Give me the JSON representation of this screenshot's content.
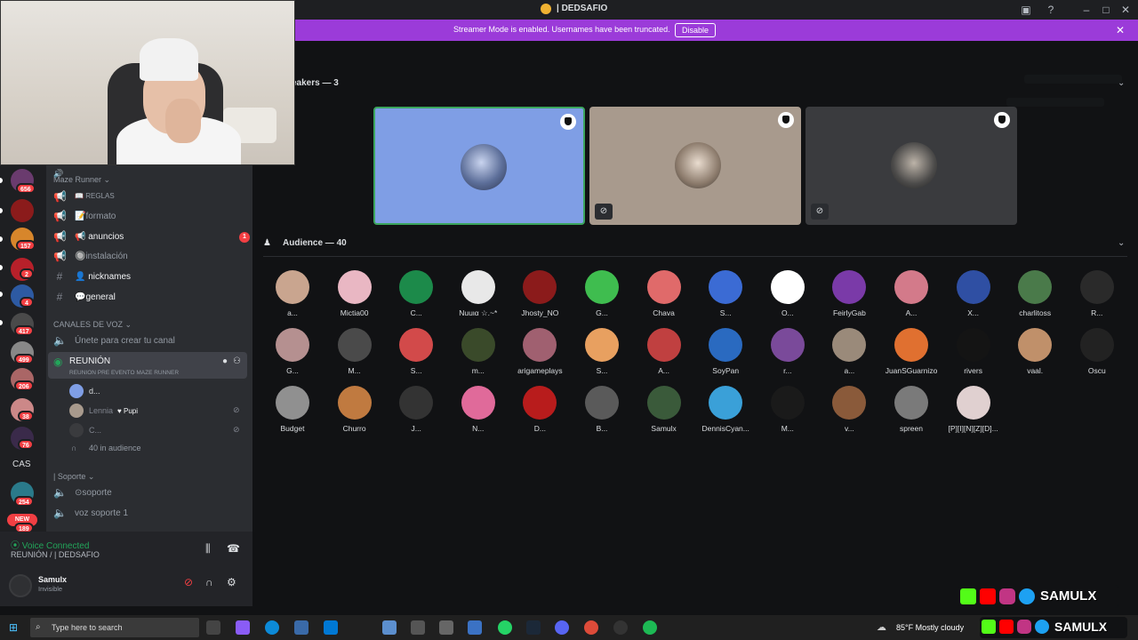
{
  "titlebar": {
    "title": "| DEDSAFIO"
  },
  "banner": {
    "text": "Streamer Mode is enabled. Usernames have been truncated.",
    "button": "Disable"
  },
  "rail": {
    "badges": [
      "656",
      "157",
      "2",
      "4",
      "417",
      "499",
      "206",
      "38",
      "76",
      "254",
      "189"
    ],
    "cas_label": "CAS",
    "new_label": "NEW"
  },
  "sidebar": {
    "category1": "Maze Runner",
    "channels": [
      {
        "icon": "📖",
        "label": "REGLAS"
      },
      {
        "icon": "📝",
        "label": "formato"
      },
      {
        "icon": "📢",
        "label": "anuncios",
        "unread": "1"
      },
      {
        "icon": "🔘",
        "label": "instalación"
      },
      {
        "icon": "👤",
        "label": "nicknames"
      },
      {
        "icon": "💬",
        "label": "general"
      }
    ],
    "voice_category": "CANALES DE VOZ",
    "create_channel": "Únete para crear tu canal",
    "reunion": {
      "title": "REUNIÓN",
      "subtitle": "REUNION PRE EVENTO MAZE RUNNER"
    },
    "voice_users": [
      "d...",
      "Lennia",
      "C..."
    ],
    "pupi": "Pupi",
    "audience_count": "40 in audience",
    "soporte_category": "| Soporte",
    "soporte_channels": [
      "⊙soporte",
      "voz soporte 1"
    ]
  },
  "voice_panel": {
    "status": "Voice Connected",
    "channel": "REUNIÓN / | DEDSAFIO"
  },
  "user_panel": {
    "name": "Samulx",
    "status": "Invisible"
  },
  "stage": {
    "speakers_header": "eakers — 3",
    "speaker_colors": [
      "#7f9ee5",
      "#a89a8d",
      "#3a3b3e"
    ],
    "audience_header": "Audience — 40",
    "audience": [
      [
        "a...",
        "Mictia00",
        "C...",
        "Nuuια ☆.~*",
        "Jhosty_NO",
        "G...",
        "Chava",
        "S...",
        "O...",
        "FeirlyGab",
        "A...",
        "X...",
        "charlitoss",
        "R..."
      ],
      [
        "G...",
        "M...",
        "S...",
        "m...",
        "arigameplays",
        "S...",
        "A...",
        "SoyPan",
        "r...",
        "a...",
        "JuanSGuarnizo",
        "rivers",
        "vaal.",
        "Oscu"
      ],
      [
        "Budget",
        "Churro",
        "J...",
        "N...",
        "D...",
        "B...",
        "Samulx",
        "DennisCyan...",
        "M...",
        "v...",
        "spreen",
        "[P][I][N][Z][D]..."
      ]
    ]
  },
  "taskbar": {
    "search_placeholder": "Type here to search",
    "weather": "85°F  Mostly cloudy"
  },
  "overlay": {
    "brand": "SAMULX"
  }
}
